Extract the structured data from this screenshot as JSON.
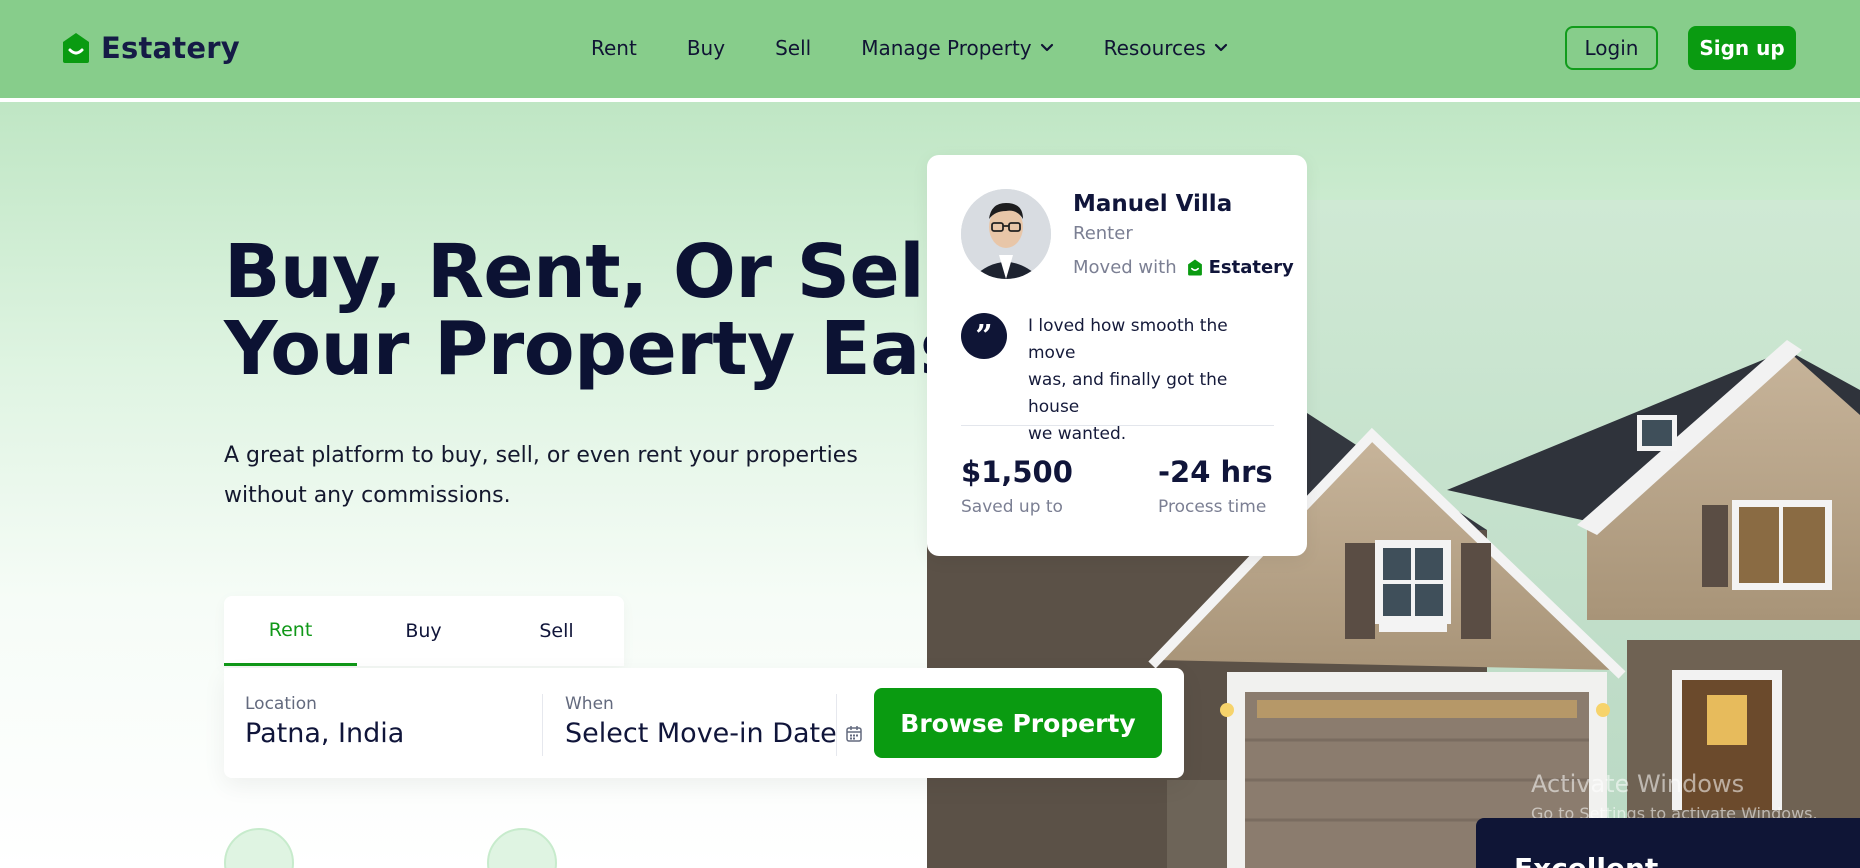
{
  "brand": {
    "name": "Estatery"
  },
  "nav": {
    "links": [
      {
        "label": "Rent",
        "has_chevron": false
      },
      {
        "label": "Buy",
        "has_chevron": false
      },
      {
        "label": "Sell",
        "has_chevron": false
      },
      {
        "label": "Manage Property",
        "has_chevron": true
      },
      {
        "label": "Resources",
        "has_chevron": true
      }
    ],
    "login_label": "Login",
    "signup_label": "Sign up"
  },
  "hero": {
    "headline_line1": "Buy, Rent, Or Sell",
    "headline_line2": "Your Property Easily",
    "subline_line1": "A great platform to buy, sell, or even rent your properties",
    "subline_line2": "without any commissions."
  },
  "testimonial": {
    "name": "Manuel Villa",
    "role": "Renter",
    "moved_with_label": "Moved with",
    "moved_with_brand": "Estatery",
    "quote_mark": "”",
    "quote_line1": "I loved how smooth the move",
    "quote_line2": "was, and finally got the house",
    "quote_line3": "we wanted.",
    "stats": [
      {
        "value": "$1,500",
        "label": "Saved up to"
      },
      {
        "value": "-24 hrs",
        "label": "Process time"
      }
    ]
  },
  "search": {
    "tabs": [
      {
        "label": "Rent",
        "active": true
      },
      {
        "label": "Buy",
        "active": false
      },
      {
        "label": "Sell",
        "active": false
      }
    ],
    "location_label": "Location",
    "location_value": "Patna, India",
    "when_label": "When",
    "when_value": "Select Move-in Date",
    "browse_label": "Browse Property"
  },
  "watermark": {
    "line1": "Activate Windows",
    "line2": "Go to Settings to activate Windows."
  },
  "rating_panel": {
    "label": "Excellent"
  },
  "colors": {
    "nav_bg": "#87cd8b",
    "brand_green": "#0a9b11",
    "navy": "#0f1536"
  },
  "icons": {
    "logo": "house-logo-icon",
    "chevron": "chevron-down-icon",
    "calendar": "calendar-icon",
    "quote": "quote-icon"
  }
}
